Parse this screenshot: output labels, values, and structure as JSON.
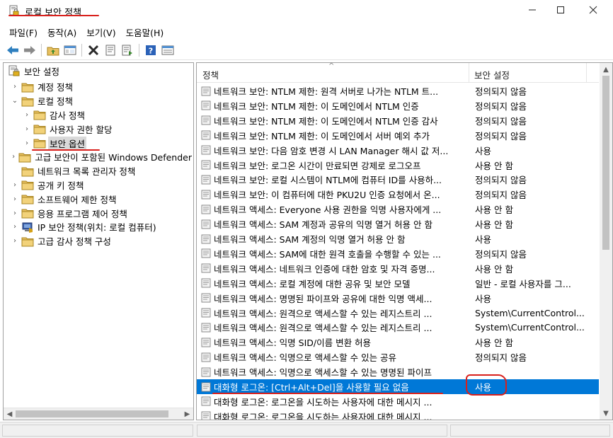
{
  "window": {
    "title": "로컬 보안 정책",
    "accent": "#0078d7",
    "annotation_color": "#d9201c"
  },
  "menu": [
    "파일(F)",
    "동작(A)",
    "보기(V)",
    "도움말(H)"
  ],
  "toolbar": [
    "back-arrow-icon",
    "forward-arrow-icon",
    "up-folder-icon",
    "show-hide-tree-icon",
    "delete-icon",
    "properties-icon",
    "export-list-icon",
    "help-icon",
    "view-icon"
  ],
  "tree": {
    "items": [
      {
        "label": "보안 설정",
        "icon": "security-settings-icon",
        "level": 0,
        "expander": ""
      },
      {
        "label": "계정 정책",
        "icon": "folder-icon",
        "level": 1,
        "expander": "›"
      },
      {
        "label": "로컬 정책",
        "icon": "folder-icon",
        "level": 1,
        "expander": "⌄"
      },
      {
        "label": "감사 정책",
        "icon": "folder-icon",
        "level": 2,
        "expander": "›"
      },
      {
        "label": "사용자 권한 할당",
        "icon": "folder-icon",
        "level": 2,
        "expander": "›"
      },
      {
        "label": "보안 옵션",
        "icon": "folder-icon",
        "level": 2,
        "expander": "›",
        "selected": true
      },
      {
        "label": "고급 보안이 포함된 Windows Defender",
        "icon": "folder-icon",
        "level": 1,
        "expander": "›"
      },
      {
        "label": "네트워크 목록 관리자 정책",
        "icon": "folder-icon",
        "level": 1,
        "expander": ""
      },
      {
        "label": "공개 키 정책",
        "icon": "folder-icon",
        "level": 1,
        "expander": "›"
      },
      {
        "label": "소프트웨어 제한 정책",
        "icon": "folder-icon",
        "level": 1,
        "expander": "›"
      },
      {
        "label": "응용 프로그램 제어 정책",
        "icon": "folder-icon",
        "level": 1,
        "expander": "›"
      },
      {
        "label": "IP 보안 정책(위치: 로컬 컴퓨터)",
        "icon": "ip-security-icon",
        "level": 1,
        "expander": "›"
      },
      {
        "label": "고급 감사 정책 구성",
        "icon": "folder-icon",
        "level": 1,
        "expander": "›"
      }
    ]
  },
  "list": {
    "columns": {
      "policy": "정책",
      "setting": "보안 설정"
    },
    "rows": [
      {
        "policy": "네트워크 보안: NTLM 제한: 원격 서버로 나가는 NTLM 트...",
        "setting": "정의되지 않음"
      },
      {
        "policy": "네트워크 보안: NTLM 제한: 이 도메인에서 NTLM 인증",
        "setting": "정의되지 않음"
      },
      {
        "policy": "네트워크 보안: NTLM 제한: 이 도메인에서 NTLM 인증 감사",
        "setting": "정의되지 않음"
      },
      {
        "policy": "네트워크 보안: NTLM 제한: 이 도메인에서 서버 예외 추가",
        "setting": "정의되지 않음"
      },
      {
        "policy": "네트워크 보안: 다음 암호 변경 시 LAN Manager 해시 값 저...",
        "setting": "사용"
      },
      {
        "policy": "네트워크 보안: 로그온 시간이 만료되면 강제로 로그오프",
        "setting": "사용 안 함"
      },
      {
        "policy": "네트워크 보안: 로컬 시스템이 NTLM에 컴퓨터 ID를 사용하...",
        "setting": "정의되지 않음"
      },
      {
        "policy": "네트워크 보안: 이 컴퓨터에 대한 PKU2U 인증 요청에서 온...",
        "setting": "정의되지 않음"
      },
      {
        "policy": "네트워크 액세스: Everyone 사용 권한을 익명 사용자에게 ...",
        "setting": "사용 안 함"
      },
      {
        "policy": "네트워크 액세스: SAM 계정과 공유의 익명 열거 허용 안 함",
        "setting": "사용 안 함"
      },
      {
        "policy": "네트워크 액세스: SAM 계정의 익명 열거 허용 안 함",
        "setting": "사용"
      },
      {
        "policy": "네트워크 액세스: SAM에 대한 원격 호출을 수행할 수 있는 ...",
        "setting": "정의되지 않음"
      },
      {
        "policy": "네트워크 액세스: 네트워크 인증에 대한 암호 및 자격 증명...",
        "setting": "사용 안 함"
      },
      {
        "policy": "네트워크 액세스: 로컬 계정에 대한 공유 및 보안 모델",
        "setting": "일반 - 로컬 사용자를 그..."
      },
      {
        "policy": "네트워크 액세스: 명명된 파이프와 공유에 대한 익명 액세...",
        "setting": "사용"
      },
      {
        "policy": "네트워크 액세스: 원격으로 액세스할 수 있는 레지스트리 ...",
        "setting": "System\\CurrentControl..."
      },
      {
        "policy": "네트워크 액세스: 원격으로 액세스할 수 있는 레지스트리 ...",
        "setting": "System\\CurrentControl..."
      },
      {
        "policy": "네트워크 액세스: 익명 SID/이름 변환 허용",
        "setting": "사용 안 함"
      },
      {
        "policy": "네트워크 액세스: 익명으로 액세스할 수 있는 공유",
        "setting": "정의되지 않음"
      },
      {
        "policy": "네트워크 액세스: 익명으로 액세스할 수 있는 명명된 파이프",
        "setting": ""
      },
      {
        "policy": "대화형 로그온: [Ctrl+Alt+Del]을 사용할 필요 없음",
        "setting": "사용",
        "selected": true
      },
      {
        "policy": "대화형 로그온: 로그온을 시도하는 사용자에 대한 메시지 ...",
        "setting": ""
      },
      {
        "policy": "대화형 로그온: 로그온을 시도하는 사용자에 대한 메시지 ...",
        "setting": ""
      }
    ]
  }
}
